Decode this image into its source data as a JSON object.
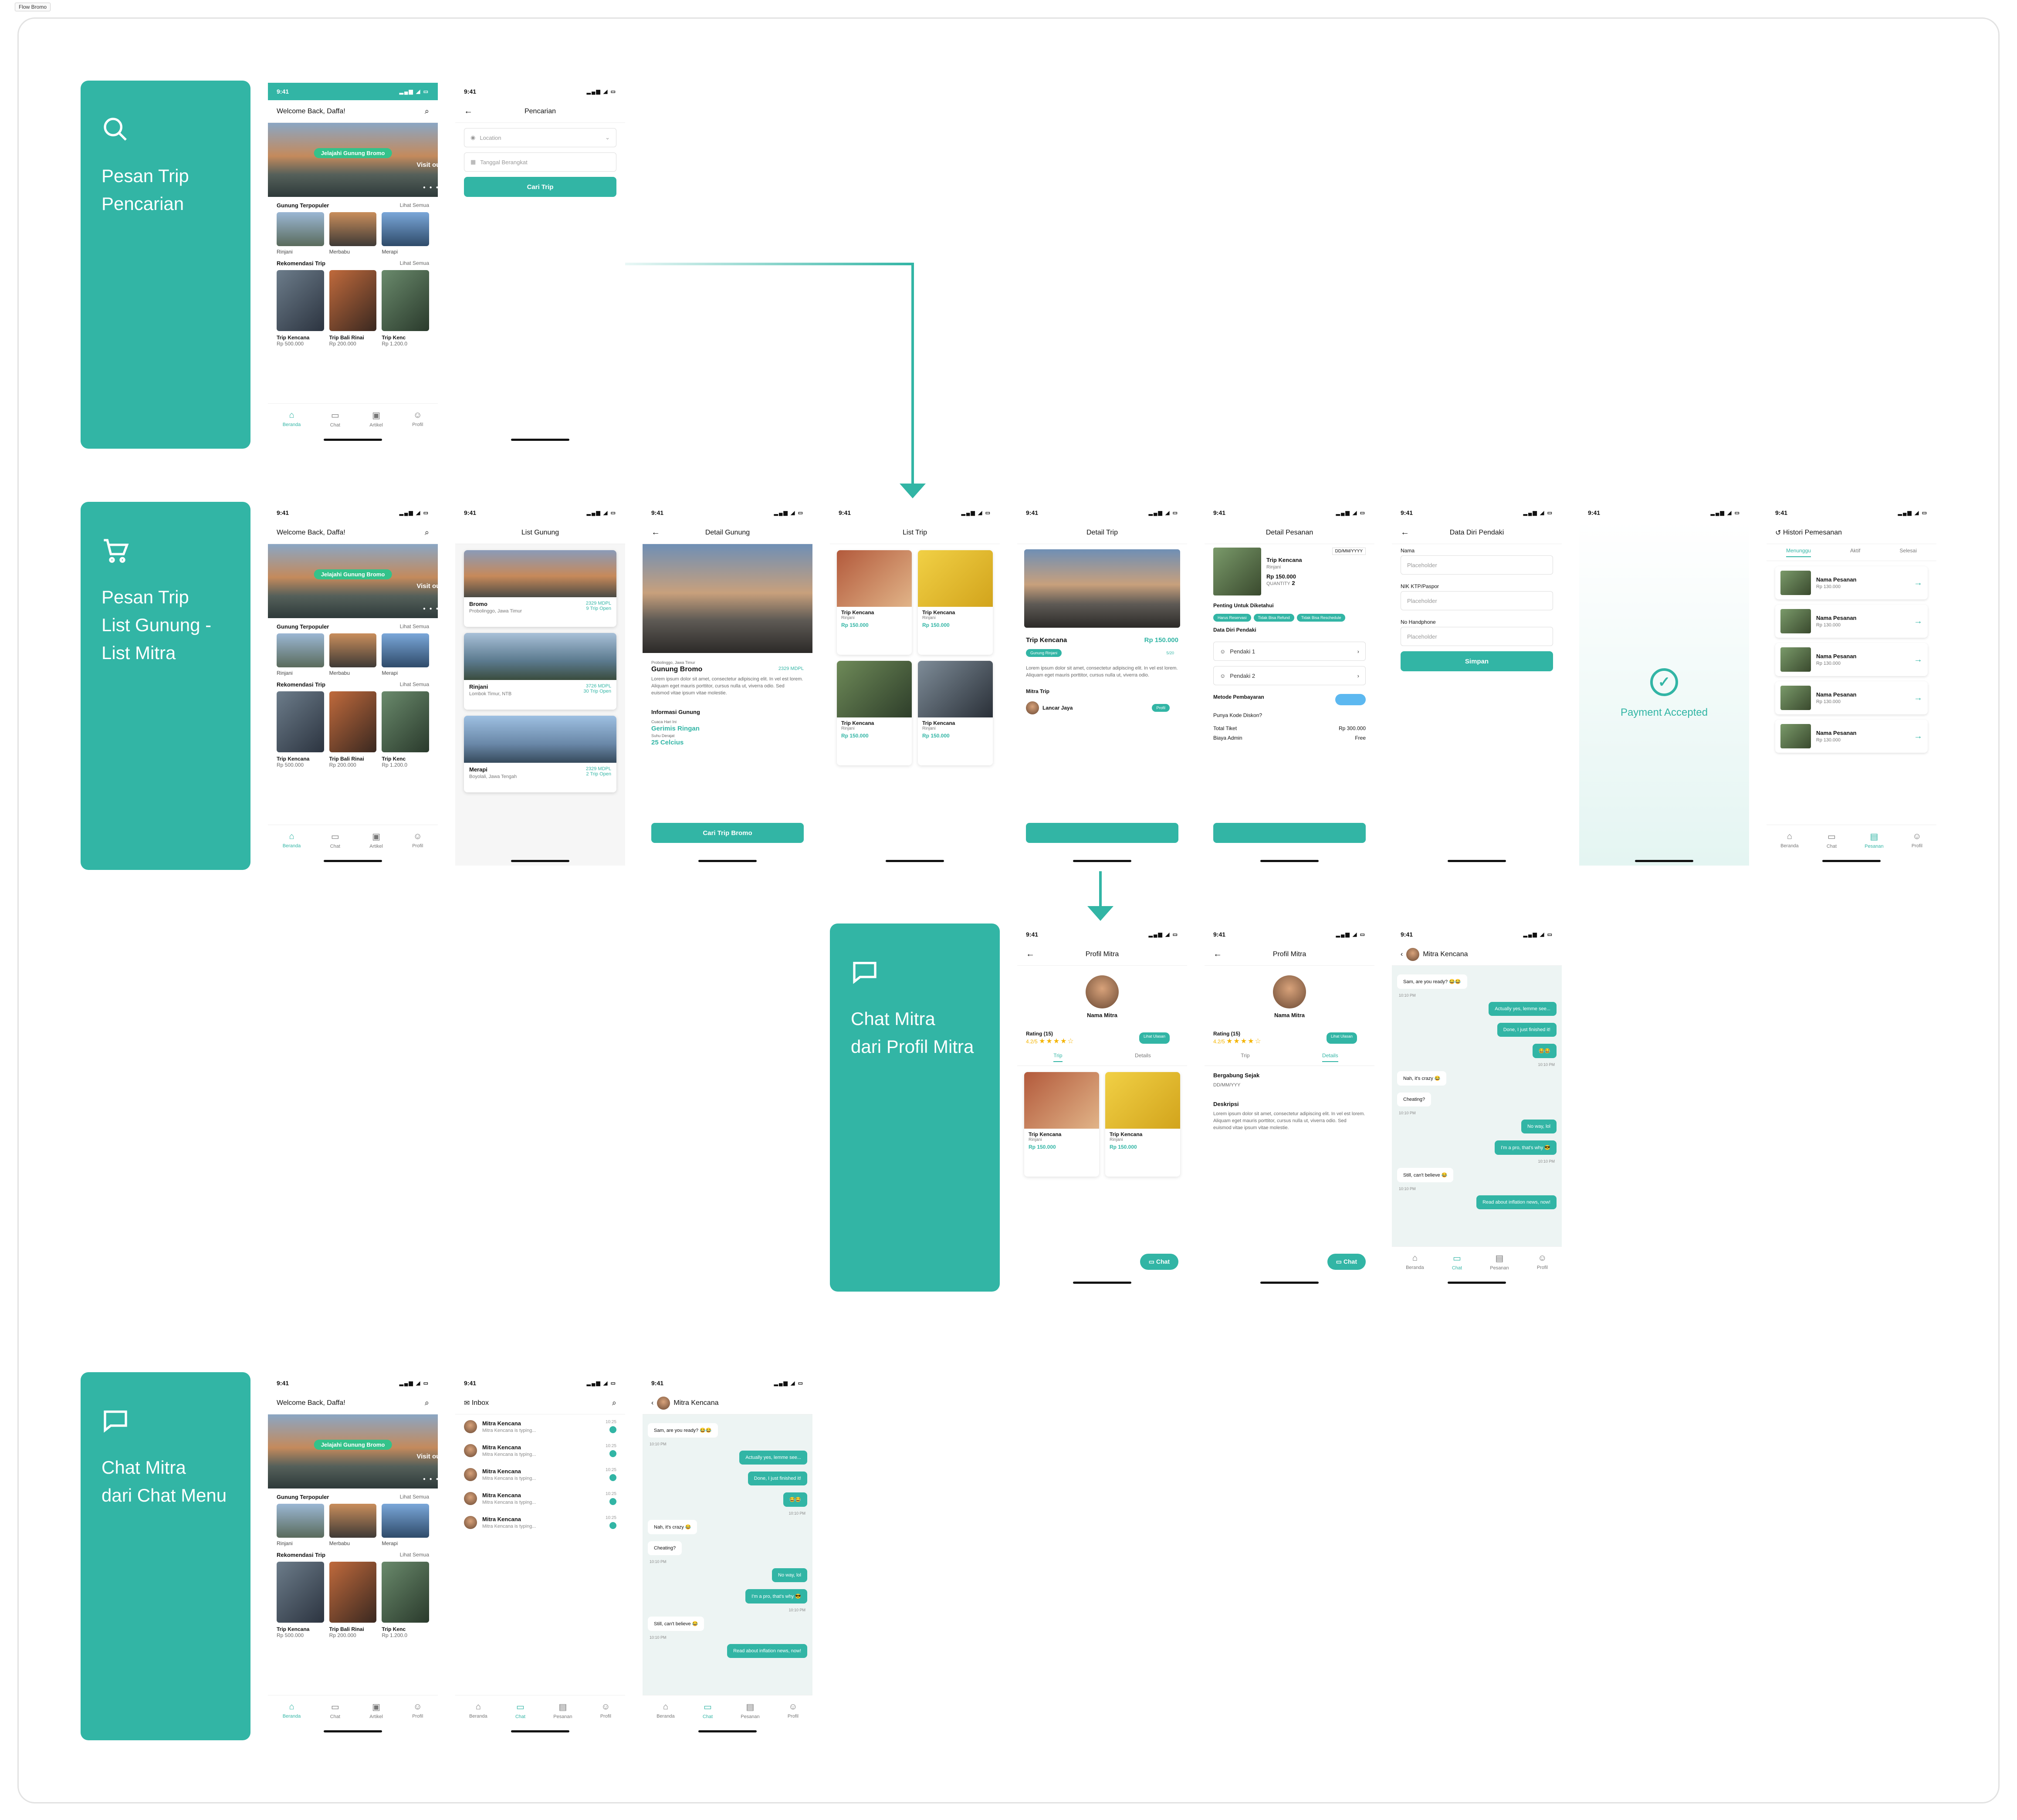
{
  "canvas_tag": "Flow Bromo",
  "flows": [
    {
      "title": "Pesan Trip\nPencarian",
      "icon": "search-icon"
    },
    {
      "title": "Pesan Trip\nList Gunung -\nList Mitra",
      "icon": "cart-icon"
    },
    {
      "title": "Chat Mitra\ndari Profil Mitra",
      "icon": "chat-icon"
    },
    {
      "title": "Chat Mitra\ndari Chat Menu",
      "icon": "chat-icon"
    }
  ],
  "status": {
    "time": "9:41",
    "signal": "▂▄▆ ◢ ▭"
  },
  "home": {
    "welcome": "Welcome Back, Daffa!",
    "banner_pill": "Jelajahi Gunung Bromo",
    "banner_sub": "Visit our trip !",
    "banner_dots": "● ● ● ● ●",
    "popular": "Gunung Terpopuler",
    "see_all": "Lihat Semua",
    "mountains": [
      "Rinjani",
      "Merbabu",
      "Merapi"
    ],
    "recommend": "Rekomendasi Trip",
    "recs": [
      {
        "name": "Trip Kencana",
        "price": "Rp 500.000"
      },
      {
        "name": "Trip Bali Rinai",
        "price": "Rp 200.000"
      },
      {
        "name": "Trip Kenc",
        "price": "Rp 1.200.0"
      }
    ]
  },
  "nav_home": [
    "Beranda",
    "Chat",
    "Artikel",
    "Profil"
  ],
  "nav_app": [
    "Beranda",
    "Chat",
    "Pesanan",
    "Profil"
  ],
  "search": {
    "title": "Pencarian",
    "location": "Location",
    "date": "Tanggal Berangkat",
    "button": "Cari Trip"
  },
  "list_gunung": {
    "title": "List Gunung",
    "items": [
      {
        "name": "Bromo",
        "loc": "Probolinggo, Jawa Timur",
        "mdpl": "2329 MDPL",
        "trips": "9 Trip Open"
      },
      {
        "name": "Rinjani",
        "loc": "Lombok Timur, NTB",
        "mdpl": "3726 MDPL",
        "trips": "30 Trip Open"
      },
      {
        "name": "Merapi",
        "loc": "Boyolali, Jawa Tengah",
        "mdpl": "2329 MDPL",
        "trips": "2 Trip Open"
      }
    ]
  },
  "detail_gunung": {
    "title": "Detail Gunung",
    "loc": "Probolinggo, Jawa Timur",
    "name": "Gunung Bromo",
    "mdpl": "2329 MDPL",
    "desc": "Lorem ipsum dolor sit amet, consectetur adipiscing elit. In vel est lorem. Aliquam eget mauris porttitor, cursus nulla ut, viverra odio. Sed euismod vitae ipsum vitae molestie.",
    "info": "Informasi Gunung",
    "cuaca_l": "Cuaca Hari Ini",
    "cuaca": "Gerimis Ringan",
    "suhu_l": "Suhu Derajat",
    "suhu": "25 Celcius",
    "button": "Cari Trip Bromo"
  },
  "list_trip": {
    "title": "List Trip",
    "items": [
      {
        "name": "Trip Kencana",
        "loc": "Rinjani",
        "price": "Rp 150.000",
        "rate": "99"
      },
      {
        "name": "Trip Kencana",
        "loc": "Rinjani",
        "price": "Rp 150.000",
        "rate": "99"
      },
      {
        "name": "Trip Kencana",
        "loc": "Rinjani",
        "price": "Rp 150.000",
        "rate": "99"
      },
      {
        "name": "Trip Kencana",
        "loc": "Rinjani",
        "price": "Rp 150.000",
        "rate": "99"
      }
    ]
  },
  "detail_trip": {
    "title": "Detail Trip",
    "name": "Trip Kencana",
    "price": "Rp 150.000",
    "tag": "Gunung Rinjani",
    "quota": "5/20",
    "desc": "Lorem ipsum dolor sit amet, consectetur adipiscing elit. In vel est lorem. Aliquam eget mauris porttitor, cursus nulla ut, viverra odio.",
    "mitra_l": "Mitra Trip",
    "mitra": "Lancar Jaya",
    "profil": "Profil"
  },
  "detail_pesanan": {
    "title": "Detail Pesanan",
    "name": "Trip Kencana",
    "loc": "Rinjani",
    "date": "DD/MM/YYYY",
    "price": "Rp 150.000",
    "qty_l": "QUANTITY",
    "qty": "2",
    "penting": "Penting Untuk Diketahui",
    "tags": [
      "Harus Reservasi",
      "Tidak Bisa Refund",
      "Tidak Bisa Reschedule"
    ],
    "data_l": "Data Diri Pendaki",
    "p1": "Pendaki 1",
    "p2": "Pendaki 2",
    "metode": "Metode Pembayaran",
    "kode": "Punya Kode Diskon?",
    "total_l": "Total Tiket",
    "total": "Rp 300.000",
    "admin_l": "Biaya Admin",
    "admin": "Free"
  },
  "data_diri": {
    "title": "Data Diri Pendaki",
    "f1": "Nama",
    "f2": "NIK KTP/Paspor",
    "f3": "No Handphone",
    "ph": "Placeholder",
    "button": "Simpan"
  },
  "payment": {
    "text": "Payment Accepted",
    "check": "✓"
  },
  "histori": {
    "title": "Histori Pemesanan",
    "tabs": [
      "Menunggu",
      "Aktif",
      "Selesai"
    ],
    "item": "Nama Pesanan",
    "price": "Rp 130.000"
  },
  "profil_mitra": {
    "title": "Profil Mitra",
    "name": "Nama Mitra",
    "rating": "Rating (15)",
    "score": "4.2/5",
    "stars": "★★★★☆",
    "ulasan": "Lihat Ulasan",
    "tabs": [
      "Trip",
      "Details"
    ],
    "chat": "Chat",
    "join_l": "Bergabung Sejak",
    "join": "DD/MM/YYY",
    "desk_l": "Deskripsi",
    "desk": "Lorem ipsum dolor sit amet, consectetur adipiscing elit. In vel est lorem. Aliquam eget mauris porttitor, cursus nulla ut, viverra odio. Sed euismod vitae ipsum vitae molestie."
  },
  "chat": {
    "name": "Mitra Kencana",
    "msgs": [
      {
        "s": "l",
        "t": "Sam, are you ready? 😂😂"
      },
      {
        "s": "r",
        "t": "Actually yes, lemme see..."
      },
      {
        "s": "r",
        "t": "Done, I just finished it!"
      },
      {
        "s": "r",
        "t": "😂😂"
      },
      {
        "s": "l",
        "t": "Nah, it's crazy 😂"
      },
      {
        "s": "l",
        "t": "Cheating?"
      },
      {
        "s": "r",
        "t": "No way, lol"
      },
      {
        "s": "r",
        "t": "I'm a pro, that's why 😎"
      },
      {
        "s": "l",
        "t": "Still, can't believe 😂"
      },
      {
        "s": "r",
        "t": "Read about inflation news, now!"
      }
    ],
    "time": "10:10 PM"
  },
  "inbox": {
    "title": "Inbox",
    "name": "Mitra Kencana",
    "msg": "Mitra Kencana is typing...",
    "time": "10:25"
  }
}
